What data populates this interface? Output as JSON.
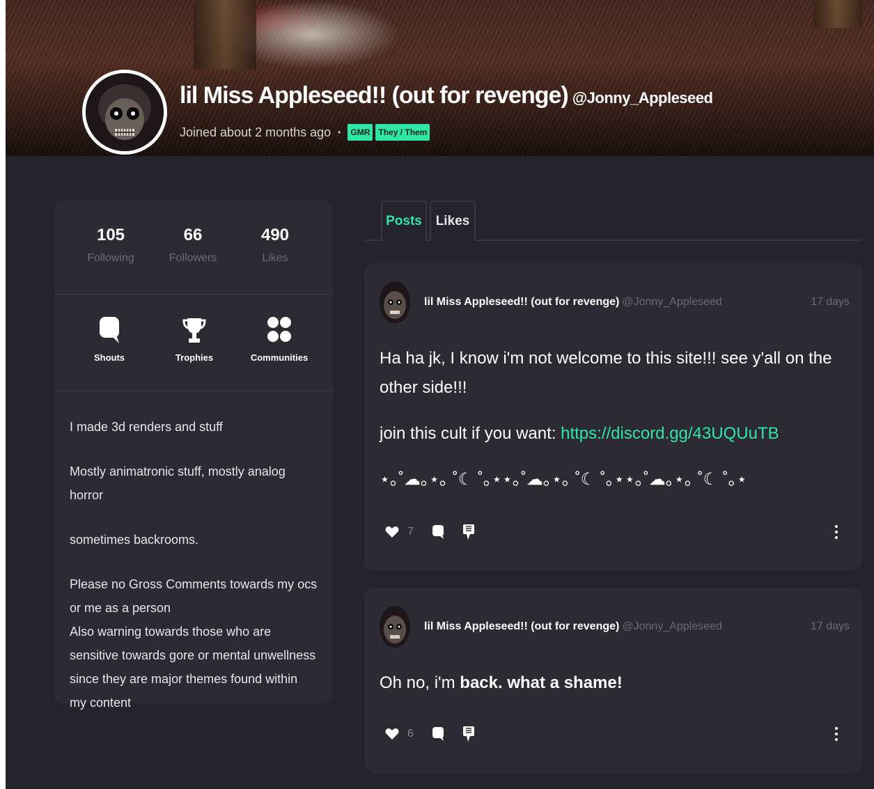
{
  "profile": {
    "display_name": "lil Miss Appleseed!! (out for revenge)",
    "handle": "@Jonny_Appleseed",
    "joined": "Joined about 2 months ago",
    "separator": "•",
    "tags": [
      "GMR",
      "They / Them"
    ]
  },
  "stats": [
    {
      "value": "105",
      "label": "Following"
    },
    {
      "value": "66",
      "label": "Followers"
    },
    {
      "value": "490",
      "label": "Likes"
    }
  ],
  "actions": [
    {
      "label": "Shouts",
      "icon": "speech-bubble-icon"
    },
    {
      "label": "Trophies",
      "icon": "trophy-icon"
    },
    {
      "label": "Communities",
      "icon": "grid-dots-icon"
    }
  ],
  "bio": {
    "line1": "I made 3d renders and stuff",
    "line2": "Mostly animatronic stuff, mostly analog horror",
    "line3": "sometimes backrooms.",
    "line4": "Please no Gross Comments towards my ocs or me as a person",
    "line5": "Also warning towards those who are sensitive towards gore or mental unwellness since they are major themes found within my content"
  },
  "tabs": {
    "posts": "Posts",
    "likes": "Likes"
  },
  "posts": [
    {
      "author": "lil Miss Appleseed!! (out for revenge)",
      "handle": "@Jonny_Appleseed",
      "time": "17 days",
      "text1": "Ha ha jk, I know i'm not welcome to this site!!! see y'all on the other side!!!",
      "text2_prefix": "join this cult if you want: ",
      "text2_link": "https://discord.gg/43UQUuTB",
      "text3": "⋆｡˚☁︎｡⋆｡ ˚☾ ˚｡⋆⋆｡˚☁︎｡⋆｡ ˚☾ ˚｡⋆⋆｡˚☁︎｡⋆｡ ˚☾ ˚｡⋆",
      "likes": "7"
    },
    {
      "author": "lil Miss Appleseed!! (out for revenge)",
      "handle": "@Jonny_Appleseed",
      "time": "17 days",
      "text_plain": "Oh no, i'm ",
      "text_bold": "back. what a shame!",
      "likes": "6"
    }
  ],
  "colors": {
    "accent": "#2ee6a6",
    "background": "#25232c",
    "card": "#2c2a33"
  }
}
